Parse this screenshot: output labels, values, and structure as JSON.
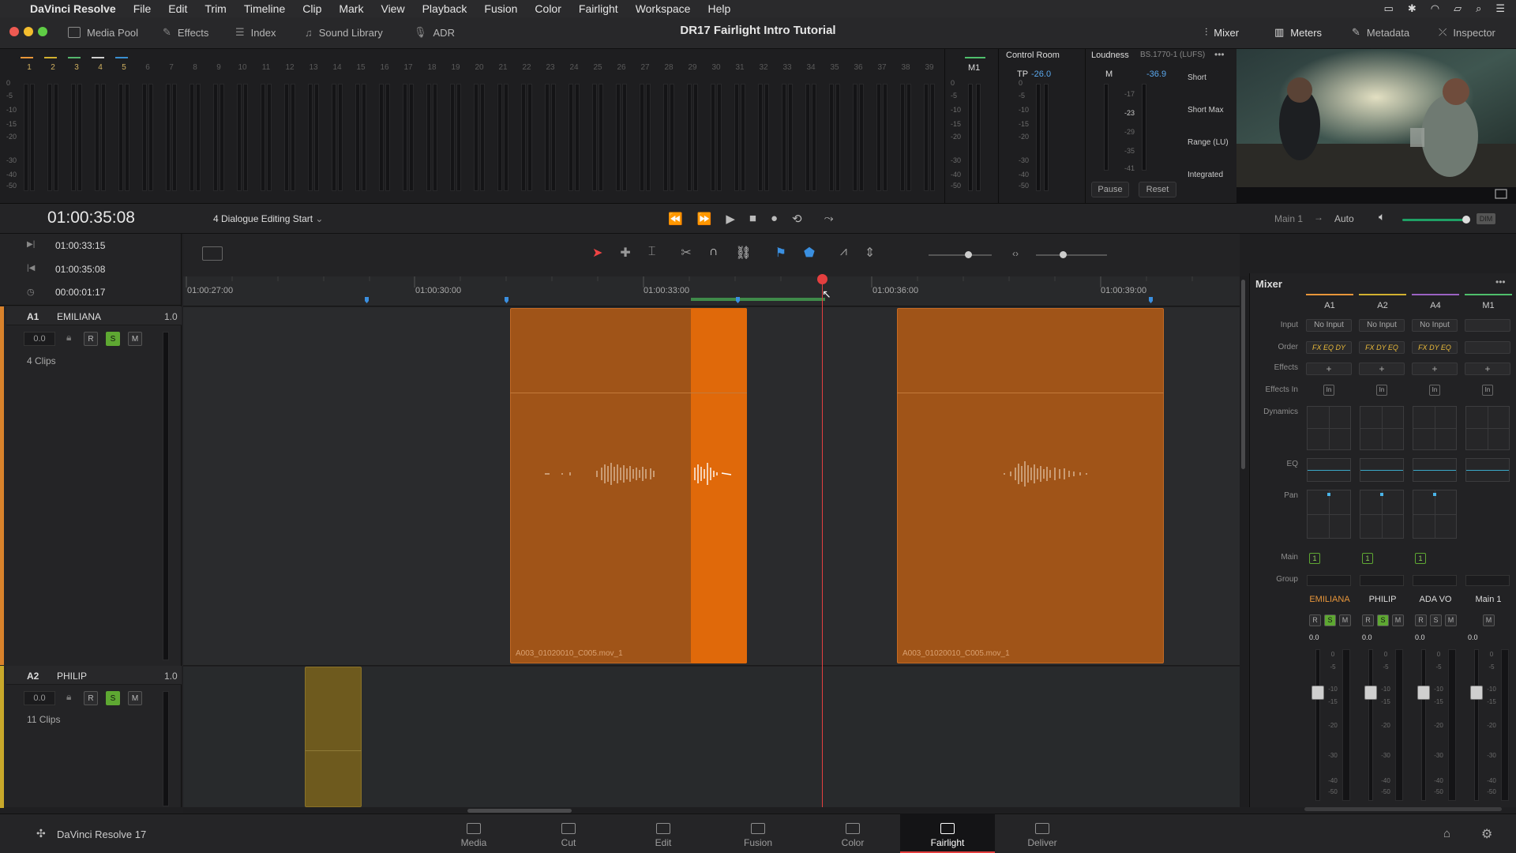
{
  "menubar": {
    "app": "DaVinci Resolve",
    "items": [
      "File",
      "Edit",
      "Trim",
      "Timeline",
      "Clip",
      "Mark",
      "View",
      "Playback",
      "Fusion",
      "Color",
      "Fairlight",
      "Workspace",
      "Help"
    ]
  },
  "toolbar_top": {
    "left": [
      "Media Pool",
      "Effects",
      "Index",
      "Sound Library",
      "ADR"
    ],
    "right": [
      "Mixer",
      "Meters",
      "Metadata",
      "Inspector"
    ],
    "title": "DR17 Fairlight Intro Tutorial"
  },
  "meters": {
    "track_nums": [
      "1",
      "2",
      "3",
      "4",
      "5",
      "6",
      "7",
      "8",
      "9",
      "10",
      "11",
      "12",
      "13",
      "14",
      "15",
      "16",
      "17",
      "18",
      "19",
      "20",
      "21",
      "22",
      "23",
      "24",
      "25",
      "26",
      "27",
      "28",
      "29",
      "30",
      "31",
      "32",
      "33",
      "34",
      "35",
      "36",
      "37",
      "38",
      "39"
    ],
    "scale": [
      "0",
      "-5",
      "-10",
      "-15",
      "-20",
      "-30",
      "-40",
      "-50"
    ],
    "bus": "M1",
    "bus_scale": [
      "0",
      "-5",
      "-10",
      "-15",
      "-20",
      "-30",
      "-40",
      "-50"
    ]
  },
  "control_room": {
    "title": "Control Room",
    "tp_label": "TP",
    "tp_value": "-26.0",
    "scale": [
      "0",
      "-5",
      "-10",
      "-15",
      "-20",
      "-30",
      "-40",
      "-50"
    ]
  },
  "loudness": {
    "title": "Loudness",
    "standard": "BS.1770-1 (LUFS)",
    "m_label": "M",
    "m_value": "-36.9",
    "scale": [
      "-17",
      "-23",
      "-29",
      "-35",
      "-41"
    ],
    "labels": [
      "Short",
      "Short Max",
      "Range (LU)",
      "Integrated"
    ],
    "pause": "Pause",
    "reset": "Reset"
  },
  "transport": {
    "timecode": "01:00:35:08",
    "timeline_name": "4 Dialogue Editing Start",
    "bus": "Main 1",
    "auto": "Auto",
    "dim": "DIM"
  },
  "tc_list": [
    "01:00:33:15",
    "01:00:35:08",
    "00:00:01:17"
  ],
  "ruler": [
    "01:00:27:00",
    "01:00:30:00",
    "01:00:33:00",
    "01:00:36:00",
    "01:00:39:00"
  ],
  "tracks": [
    {
      "id": "A1",
      "name": "EMILIANA",
      "level": "1.0",
      "vol": "0.0",
      "clips": "4 Clips",
      "color": "#d9822b"
    },
    {
      "id": "A2",
      "name": "PHILIP",
      "level": "1.0",
      "vol": "0.0",
      "clips": "11 Clips",
      "color": "#c8a82a"
    }
  ],
  "clip_names": [
    "A003_01020010_C005.mov_1",
    "A003_01020010_C005.mov_1"
  ],
  "mixer": {
    "title": "Mixer",
    "rows": [
      "Input",
      "Order",
      "Effects",
      "Effects In",
      "Dynamics",
      "EQ",
      "Pan",
      "Main",
      "Group"
    ],
    "channels": [
      {
        "id": "A1",
        "input": "No Input",
        "order": "FX EQ DY",
        "name": "EMILIANA",
        "gain": "0.0",
        "color": "#e8963a"
      },
      {
        "id": "A2",
        "input": "No Input",
        "order": "FX DY EQ",
        "name": "PHILIP",
        "gain": "0.0",
        "color": "#d1b030"
      },
      {
        "id": "A4",
        "input": "No Input",
        "order": "FX DY EQ",
        "name": "ADA VO",
        "gain": "0.0",
        "color": "#9a62c2"
      },
      {
        "id": "M1",
        "input": "",
        "order": "",
        "name": "Main 1",
        "gain": "0.0",
        "color": "#4fbf6c"
      }
    ],
    "fader_scale": [
      "0",
      "-5",
      "-10",
      "-15",
      "-20",
      "-30",
      "-40",
      "-50"
    ]
  },
  "pages": [
    "Media",
    "Cut",
    "Edit",
    "Fusion",
    "Color",
    "Fairlight",
    "Deliver"
  ],
  "footer_app": "DaVinci Resolve 17",
  "colors": {
    "accent": "#e43f3f",
    "clip": "#a05418",
    "clip_selected": "#e0690a",
    "solo": "#5ea832",
    "philip_clip": "#6e5a1e"
  }
}
